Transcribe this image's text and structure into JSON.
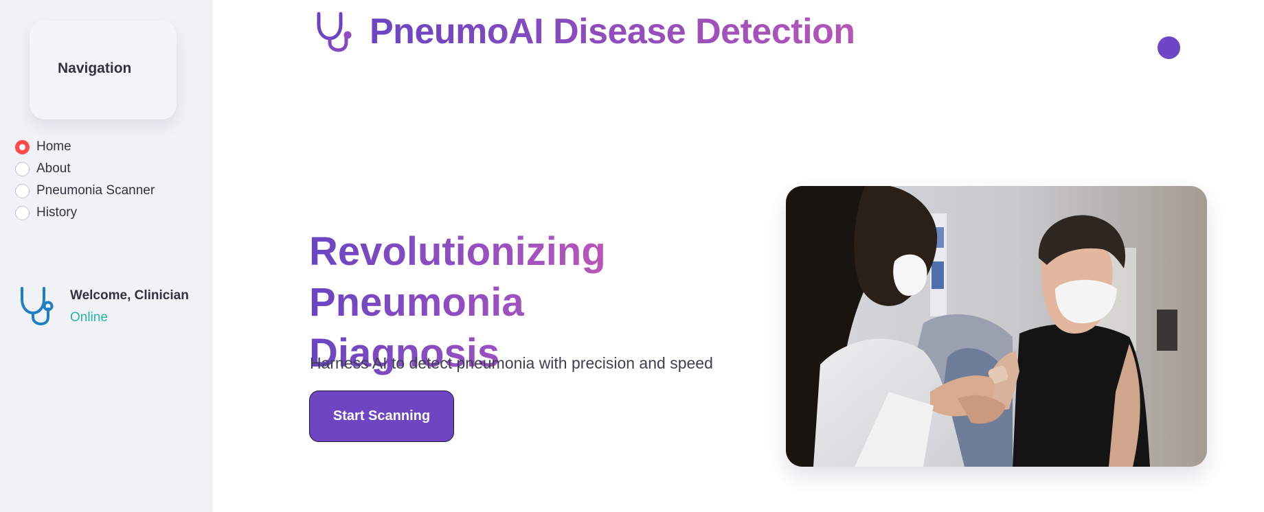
{
  "sidebar": {
    "nav_title": "Navigation",
    "items": [
      {
        "label": "Home",
        "selected": true
      },
      {
        "label": "About",
        "selected": false
      },
      {
        "label": "Pneumonia Scanner",
        "selected": false
      },
      {
        "label": "History",
        "selected": false
      }
    ],
    "welcome": {
      "name": "Welcome, Clinician",
      "status": "Online",
      "icon": "stethoscope-icon"
    }
  },
  "header": {
    "title": "PneumoAI Disease Detection",
    "icon": "stethoscope-icon"
  },
  "hero": {
    "title_line1": "Revolutionizing",
    "title_line2": "Pneumonia Diagnosis",
    "subtitle": "Harness AI to detect pneumonia with precision and speed",
    "button_label": "Start Scanning",
    "image": "doctor-vaccinating-patient-photo"
  },
  "colors": {
    "accent": "#6f45c4",
    "gradient_end": "#de5bab",
    "selected_radio": "#ff4b4b",
    "online": "#26b5a2",
    "sidebar_bg": "#f0f2f6"
  }
}
